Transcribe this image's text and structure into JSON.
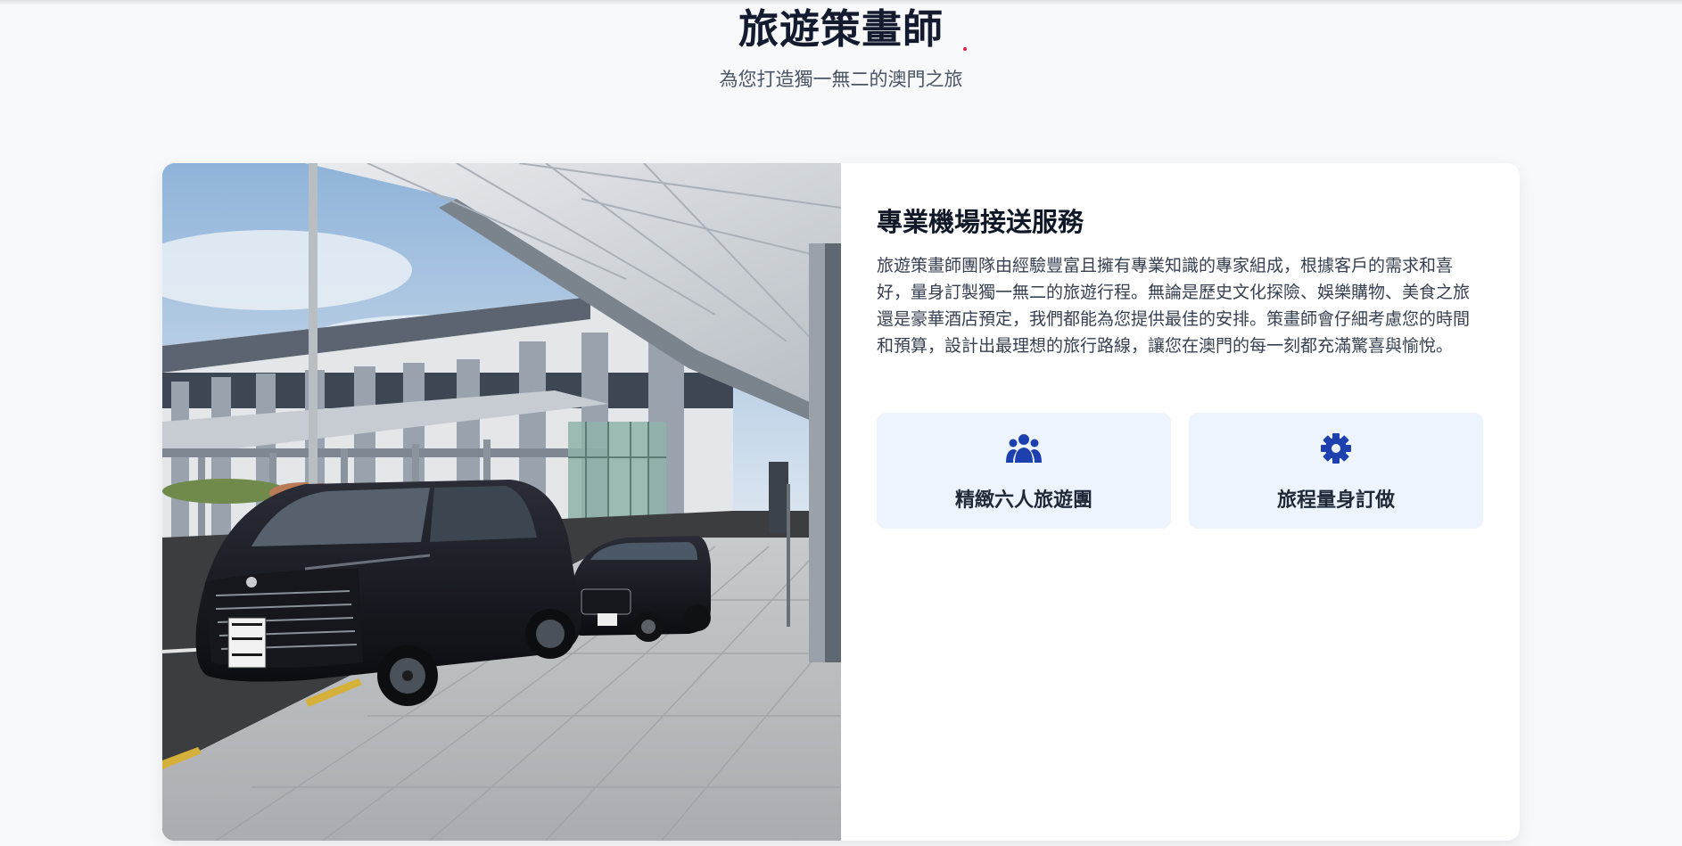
{
  "hero": {
    "title": "旅遊策畫師",
    "subtitle": "為您打造獨一無二的澳門之旅"
  },
  "service": {
    "image_alt": "airport-transfer-photo",
    "title": "專業機場接送服務",
    "description": "旅遊策畫師團隊由經驗豐富且擁有專業知識的專家組成，根據客戶的需求和喜好，量身訂製獨一無二的旅遊行程。無論是歷史文化探險、娛樂購物、美食之旅還是豪華酒店預定，我們都能為您提供最佳的安排。策畫師會仔細考慮您的時間和預算，設計出最理想的旅行路線，讓您在澳門的每一刻都充滿驚喜與愉悅。",
    "features": [
      {
        "icon": "group-icon",
        "label": "精緻六人旅遊團"
      },
      {
        "icon": "gear-icon",
        "label": "旅程量身訂做"
      }
    ]
  },
  "colors": {
    "accent": "#1e40af",
    "feature_bg": "#eef4fe",
    "page_bg": "#f7f9fb"
  }
}
